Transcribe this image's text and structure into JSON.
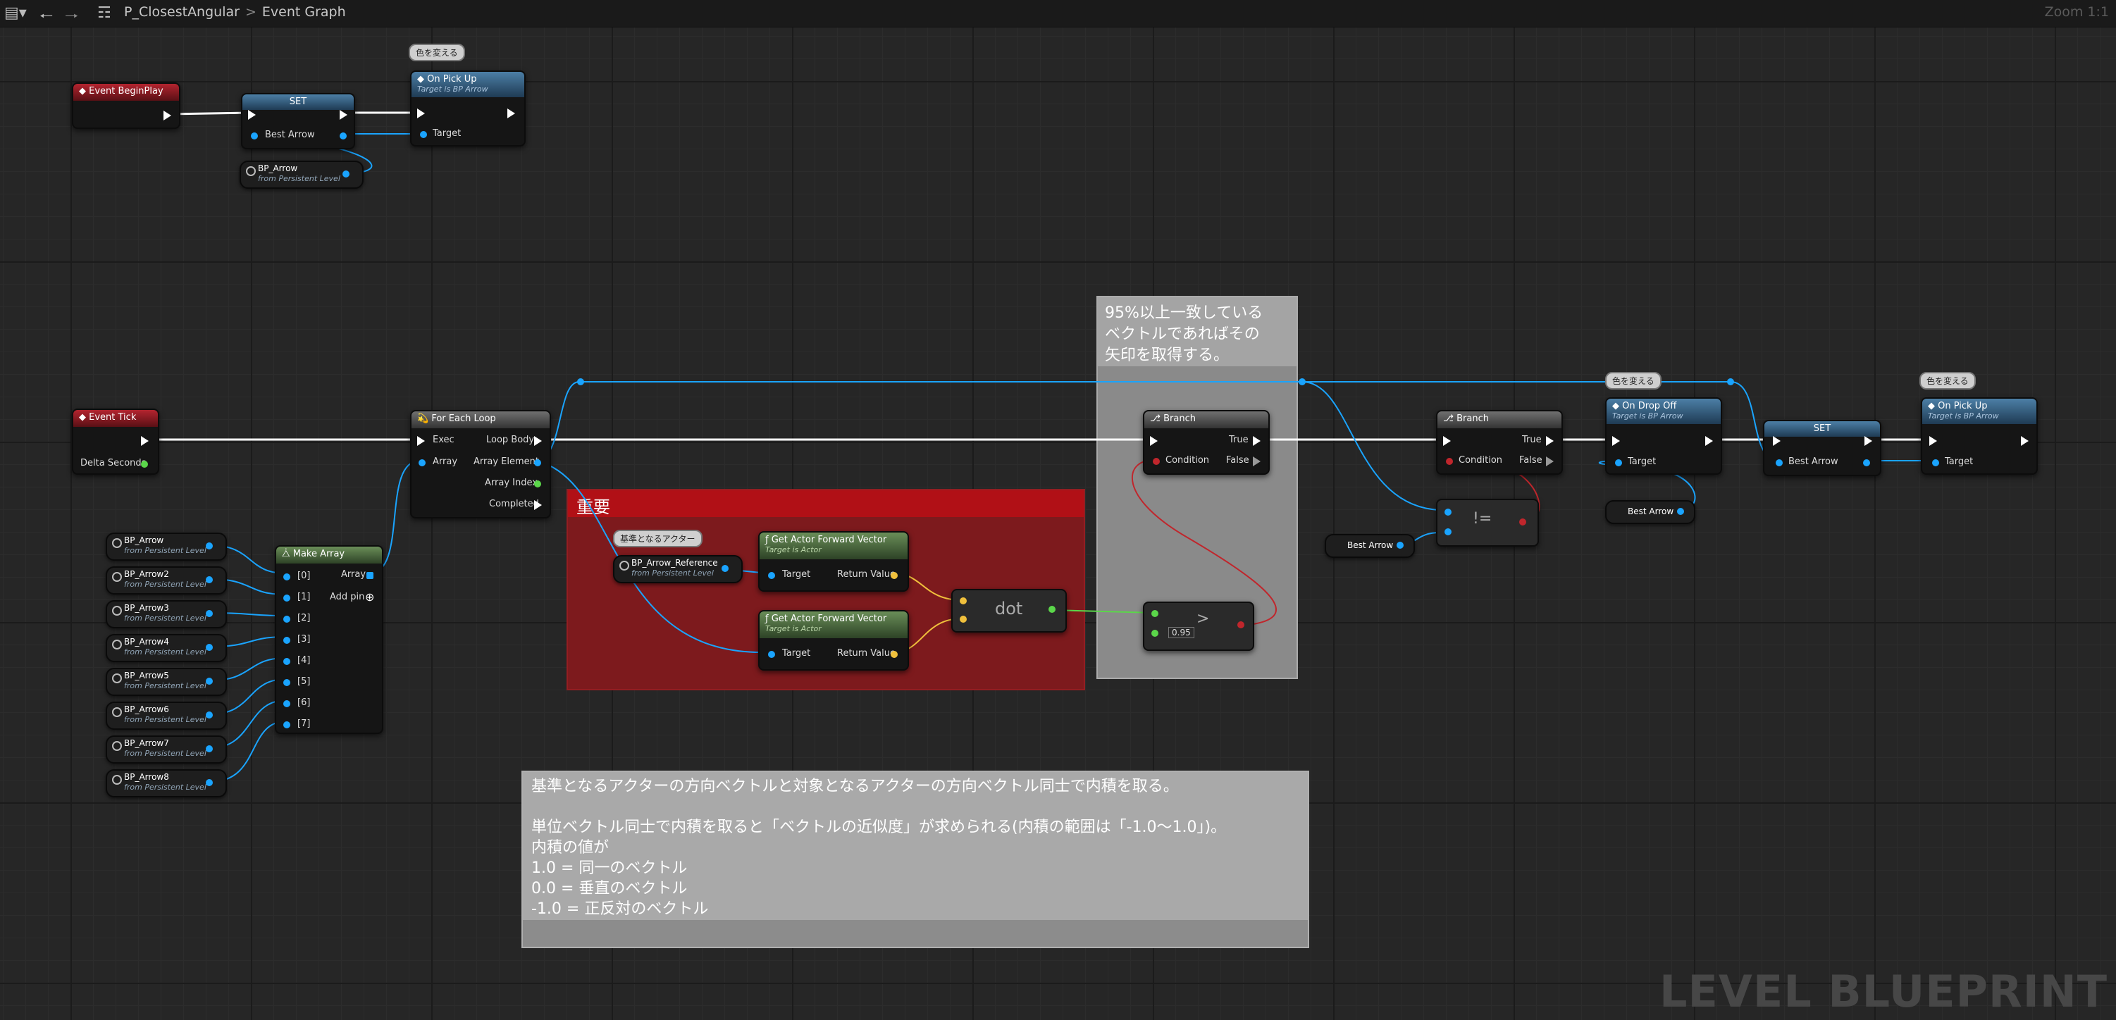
{
  "toolbar": {
    "breadcrumb_graph_name": "P_ClosestAngular",
    "breadcrumb_separator": ">",
    "breadcrumb_page": "Event Graph",
    "zoom_label": "Zoom 1:1"
  },
  "watermark": "LEVEL BLUEPRINT",
  "icons": [
    "blueprint-menu-icon",
    "back-arrow-icon",
    "forward-arrow-icon",
    "graph-hierarchy-icon"
  ],
  "colors": {
    "exec_wire": "#ffffff",
    "object_wire": "#1aa4ff",
    "vector_wire": "#f0c03c",
    "float_wire": "#5bd64a",
    "bool_wire": "#c0262c",
    "important_comment": "#7d1a1d",
    "grey_comment": "#8c8c8c"
  },
  "nodes": {
    "begin_play": {
      "title": "Event BeginPlay"
    },
    "set1": {
      "title": "SET",
      "pin_best_arrow": "Best Arrow"
    },
    "on_pickup1": {
      "title": "On Pick Up",
      "subtitle": "Target is BP Arrow",
      "pin_target": "Target",
      "tag": "色を変える"
    },
    "bp_arrow_top": {
      "title": "BP_Arrow",
      "subtitle": "from Persistent Level"
    },
    "event_tick": {
      "title": "Event Tick",
      "pin_delta": "Delta Seconds"
    },
    "for_each": {
      "title": "For Each Loop",
      "pin_exec": "Exec",
      "pin_array": "Array",
      "pin_loop_body": "Loop Body",
      "pin_array_element": "Array Element",
      "pin_array_index": "Array Index",
      "pin_completed": "Completed"
    },
    "make_array": {
      "title": "Make Array",
      "pins": [
        "[0]",
        "[1]",
        "[2]",
        "[3]",
        "[4]",
        "[5]",
        "[6]",
        "[7]"
      ],
      "pin_array": "Array",
      "pin_add": "Add pin"
    },
    "arrows": [
      {
        "title": "BP_Arrow",
        "subtitle": "from Persistent Level"
      },
      {
        "title": "BP_Arrow2",
        "subtitle": "from Persistent Level"
      },
      {
        "title": "BP_Arrow3",
        "subtitle": "from Persistent Level"
      },
      {
        "title": "BP_Arrow4",
        "subtitle": "from Persistent Level"
      },
      {
        "title": "BP_Arrow5",
        "subtitle": "from Persistent Level"
      },
      {
        "title": "BP_Arrow6",
        "subtitle": "from Persistent Level"
      },
      {
        "title": "BP_Arrow7",
        "subtitle": "from Persistent Level"
      },
      {
        "title": "BP_Arrow8",
        "subtitle": "from Persistent Level"
      }
    ],
    "ref_tag": "基準となるアクター",
    "ref": {
      "title": "BP_Arrow_Reference",
      "subtitle": "from Persistent Level"
    },
    "gafv1": {
      "title": "Get Actor Forward Vector",
      "subtitle": "Target is Actor",
      "pin_target": "Target",
      "pin_return": "Return Value"
    },
    "gafv2": {
      "title": "Get Actor Forward Vector",
      "subtitle": "Target is Actor",
      "pin_target": "Target",
      "pin_return": "Return Value"
    },
    "dot": {
      "title": "dot"
    },
    "greater": {
      "symbol": ">",
      "value": "0.95"
    },
    "branch1": {
      "title": "Branch",
      "pin_condition": "Condition",
      "pin_true": "True",
      "pin_false": "False"
    },
    "branch2": {
      "title": "Branch",
      "pin_condition": "Condition",
      "pin_true": "True",
      "pin_false": "False"
    },
    "not_equal": {
      "symbol": "!="
    },
    "best_arrow_get1": {
      "title": "Best Arrow"
    },
    "on_drop_off": {
      "title": "On Drop Off",
      "subtitle": "Target is BP Arrow",
      "pin_target": "Target",
      "tag": "色を変える"
    },
    "best_arrow_get2": {
      "title": "Best Arrow"
    },
    "set2": {
      "title": "SET",
      "pin_best_arrow": "Best Arrow"
    },
    "on_pickup2": {
      "title": "On Pick Up",
      "subtitle": "Target is BP Arrow",
      "pin_target": "Target",
      "tag": "色を変える"
    }
  },
  "comments": {
    "important": "重要",
    "branch_note": "95%以上一致している\nベクトルであればその\n矢印を取得する。",
    "big_note": "基準となるアクターの方向ベクトルと対象となるアクターの方向ベクトル同士で内積を取る。\n\n単位ベクトル同士で内積を取ると「ベクトルの近似度」が求められる(内積の範囲は「-1.0～1.0」)。\n内積の値が\n1.0 = 同一のベクトル\n0.0 = 垂直のベクトル\n-1.0 = 正反対のベクトル"
  }
}
